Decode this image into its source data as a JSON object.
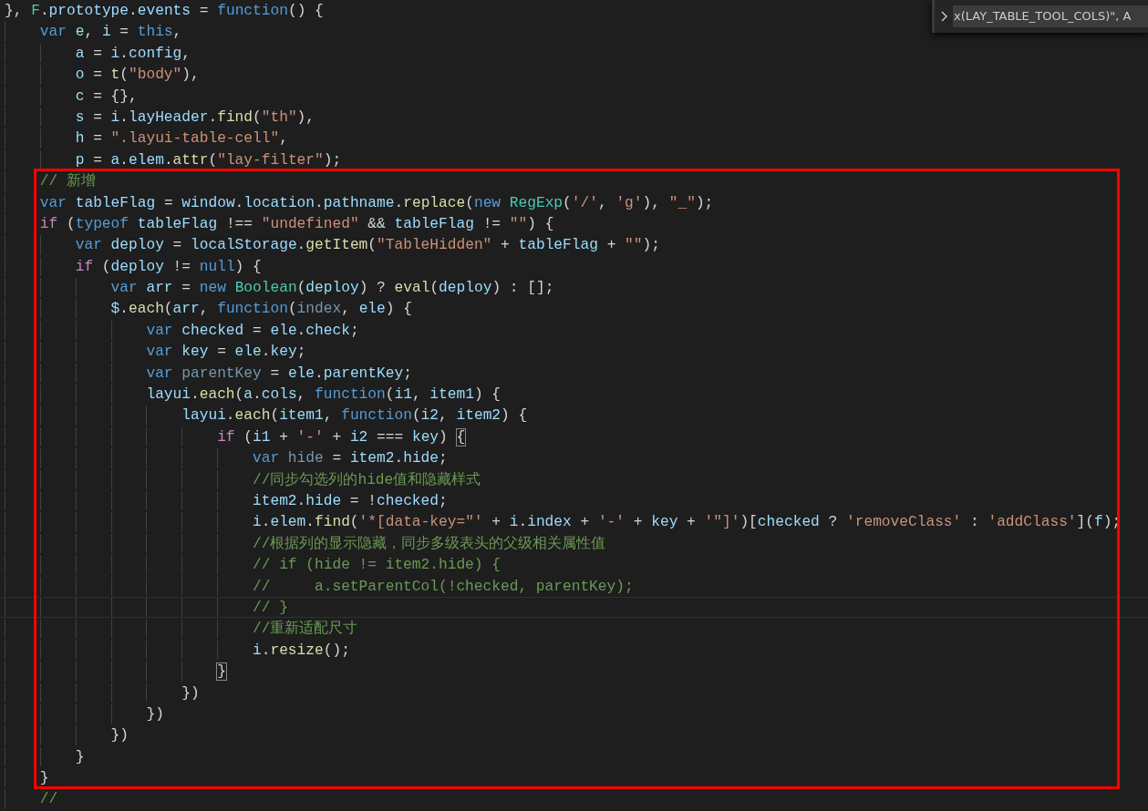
{
  "editor": {
    "lines": [
      {
        "current": false,
        "tokens": [
          {
            "kind": "plain",
            "text": "},"
          },
          {
            "kind": "type",
            "text": "F"
          },
          {
            "kind": "plain",
            "text": "."
          },
          {
            "kind": "variable",
            "text": "prototype"
          },
          {
            "kind": "plain",
            "text": "."
          },
          {
            "kind": "variable",
            "text": "events"
          },
          {
            "kind": "plain",
            "text": "="
          },
          {
            "kind": "keyword",
            "text": "function"
          },
          {
            "kind": "plain",
            "text": "() {"
          }
        ],
        "children": [
          {
            "current": false,
            "tokens": [
              {
                "kind": "keyword",
                "text": "var"
              },
              {
                "kind": "variable",
                "text": "e"
              },
              {
                "kind": "plain",
                "text": ","
              },
              {
                "kind": "variable",
                "text": "i"
              },
              {
                "kind": "plain",
                "text": "="
              },
              {
                "kind": "keyword",
                "text": "this"
              },
              {
                "kind": "plain",
                "text": ","
              }
            ],
            "children": [
              {
                "current": false,
                "tokens": [
                  {
                    "kind": "variable",
                    "text": "a"
                  },
                  {
                    "kind": "plain",
                    "text": "="
                  },
                  {
                    "kind": "variable",
                    "text": "i"
                  },
                  {
                    "kind": "plain",
                    "text": "."
                  },
                  {
                    "kind": "variable",
                    "text": "config"
                  },
                  {
                    "kind": "plain",
                    "text": ","
                  }
                ]
              },
              {
                "current": false,
                "tokens": [
                  {
                    "kind": "variable",
                    "text": "o"
                  },
                  {
                    "kind": "plain",
                    "text": "="
                  },
                  {
                    "kind": "function",
                    "text": "t"
                  },
                  {
                    "kind": "plain",
                    "text": "("
                  },
                  {
                    "kind": "string",
                    "text": "\"body\""
                  },
                  {
                    "kind": "plain",
                    "text": "),"
                  }
                ]
              },
              {
                "current": false,
                "tokens": [
                  {
                    "kind": "variable",
                    "text": "c"
                  },
                  {
                    "kind": "plain",
                    "text": "= {},"
                  }
                ]
              },
              {
                "current": false,
                "tokens": [
                  {
                    "kind": "variable",
                    "text": "s"
                  },
                  {
                    "kind": "plain",
                    "text": "="
                  },
                  {
                    "kind": "variable",
                    "text": "i"
                  },
                  {
                    "kind": "plain",
                    "text": "."
                  },
                  {
                    "kind": "variable",
                    "text": "layHeader"
                  },
                  {
                    "kind": "plain",
                    "text": "."
                  },
                  {
                    "kind": "function",
                    "text": "find"
                  },
                  {
                    "kind": "plain",
                    "text": "("
                  },
                  {
                    "kind": "string",
                    "text": "\"th\""
                  },
                  {
                    "kind": "plain",
                    "text": "),"
                  }
                ]
              },
              {
                "current": false,
                "tokens": [
                  {
                    "kind": "variable",
                    "text": "h"
                  },
                  {
                    "kind": "plain",
                    "text": "="
                  },
                  {
                    "kind": "string",
                    "text": "\".layui-table-cell\""
                  },
                  {
                    "kind": "plain",
                    "text": ","
                  }
                ]
              },
              {
                "current": false,
                "tokens": [
                  {
                    "kind": "variable",
                    "text": "p"
                  },
                  {
                    "kind": "plain",
                    "text": "="
                  },
                  {
                    "kind": "variable",
                    "text": "a"
                  },
                  {
                    "kind": "plain",
                    "text": "."
                  },
                  {
                    "kind": "variable",
                    "text": "elem"
                  },
                  {
                    "kind": "plain",
                    "text": "."
                  },
                  {
                    "kind": "function",
                    "text": "attr"
                  },
                  {
                    "kind": "plain",
                    "text": "("
                  },
                  {
                    "kind": "string",
                    "text": "\"lay-filter\""
                  },
                  {
                    "kind": "plain",
                    "text": ");"
                  }
                ]
              }
            ]
          },
          {
            "current": false,
            "tokens": [
              {
                "kind": "comment",
                "text": "// 新增"
              }
            ]
          },
          {
            "current": false,
            "tokens": [
              {
                "kind": "keyword",
                "text": "var"
              },
              {
                "kind": "variable",
                "text": "tableFlag"
              },
              {
                "kind": "plain",
                "text": "="
              },
              {
                "kind": "variable",
                "text": "window"
              },
              {
                "kind": "plain",
                "text": "."
              },
              {
                "kind": "variable",
                "text": "location"
              },
              {
                "kind": "plain",
                "text": "."
              },
              {
                "kind": "variable",
                "text": "pathname"
              },
              {
                "kind": "plain",
                "text": "."
              },
              {
                "kind": "function",
                "text": "replace"
              },
              {
                "kind": "plain",
                "text": "("
              },
              {
                "kind": "keyword",
                "text": "new"
              },
              {
                "kind": "type",
                "text": "RegExp"
              },
              {
                "kind": "plain",
                "text": "("
              },
              {
                "kind": "string",
                "text": "'/'"
              },
              {
                "kind": "plain",
                "text": ","
              },
              {
                "kind": "string",
                "text": "'g'"
              },
              {
                "kind": "plain",
                "text": "),"
              },
              {
                "kind": "string",
                "text": "\"_\""
              },
              {
                "kind": "plain",
                "text": ");"
              }
            ]
          },
          {
            "current": false,
            "tokens": [
              {
                "kind": "control",
                "text": "if"
              },
              {
                "kind": "plain",
                "text": "("
              },
              {
                "kind": "keyword",
                "text": "typeof"
              },
              {
                "kind": "variable",
                "text": "tableFlag"
              },
              {
                "kind": "plain",
                "text": "!=="
              },
              {
                "kind": "string",
                "text": "\"undefined\""
              },
              {
                "kind": "plain",
                "text": "&&"
              },
              {
                "kind": "variable",
                "text": "tableFlag"
              },
              {
                "kind": "plain",
                "text": "!="
              },
              {
                "kind": "string",
                "text": "\"\""
              },
              {
                "kind": "plain",
                "text": ") {"
              }
            ],
            "children": [
              {
                "current": false,
                "tokens": [
                  {
                    "kind": "keyword",
                    "text": "var"
                  },
                  {
                    "kind": "variable",
                    "text": "deploy"
                  },
                  {
                    "kind": "plain",
                    "text": "="
                  },
                  {
                    "kind": "variable",
                    "text": "localStorage"
                  },
                  {
                    "kind": "plain",
                    "text": "."
                  },
                  {
                    "kind": "function",
                    "text": "getItem"
                  },
                  {
                    "kind": "plain",
                    "text": "("
                  },
                  {
                    "kind": "string",
                    "text": "\"TableHidden\""
                  },
                  {
                    "kind": "plain",
                    "text": "+"
                  },
                  {
                    "kind": "variable",
                    "text": "tableFlag"
                  },
                  {
                    "kind": "plain",
                    "text": "+"
                  },
                  {
                    "kind": "string",
                    "text": "\"\""
                  },
                  {
                    "kind": "plain",
                    "text": ");"
                  }
                ]
              },
              {
                "current": false,
                "tokens": [
                  {
                    "kind": "control",
                    "text": "if"
                  },
                  {
                    "kind": "plain",
                    "text": "("
                  },
                  {
                    "kind": "variable",
                    "text": "deploy"
                  },
                  {
                    "kind": "plain",
                    "text": "!="
                  },
                  {
                    "kind": "keyword",
                    "text": "null"
                  },
                  {
                    "kind": "plain",
                    "text": ") {"
                  }
                ],
                "children": [
                  {
                    "current": false,
                    "tokens": [
                      {
                        "kind": "keyword",
                        "text": "var"
                      },
                      {
                        "kind": "variable",
                        "text": "arr"
                      },
                      {
                        "kind": "plain",
                        "text": "="
                      },
                      {
                        "kind": "keyword",
                        "text": "new"
                      },
                      {
                        "kind": "type",
                        "text": "Boolean"
                      },
                      {
                        "kind": "plain",
                        "text": "("
                      },
                      {
                        "kind": "variable",
                        "text": "deploy"
                      },
                      {
                        "kind": "plain",
                        "text": ") ?"
                      },
                      {
                        "kind": "function",
                        "text": "eval"
                      },
                      {
                        "kind": "plain",
                        "text": "("
                      },
                      {
                        "kind": "variable",
                        "text": "deploy"
                      },
                      {
                        "kind": "plain",
                        "text": ") : [];"
                      }
                    ]
                  },
                  {
                    "current": false,
                    "tokens": [
                      {
                        "kind": "variable",
                        "text": "$"
                      },
                      {
                        "kind": "plain",
                        "text": "."
                      },
                      {
                        "kind": "function",
                        "text": "each"
                      },
                      {
                        "kind": "plain",
                        "text": "("
                      },
                      {
                        "kind": "variable",
                        "text": "arr"
                      },
                      {
                        "kind": "plain",
                        "text": ","
                      },
                      {
                        "kind": "keyword",
                        "text": "function"
                      },
                      {
                        "kind": "plain",
                        "text": "("
                      },
                      {
                        "kind": "unused",
                        "text": "index"
                      },
                      {
                        "kind": "plain",
                        "text": ","
                      },
                      {
                        "kind": "variable",
                        "text": "ele"
                      },
                      {
                        "kind": "plain",
                        "text": ") {"
                      }
                    ],
                    "children": [
                      {
                        "current": false,
                        "tokens": [
                          {
                            "kind": "keyword",
                            "text": "var"
                          },
                          {
                            "kind": "variable",
                            "text": "checked"
                          },
                          {
                            "kind": "plain",
                            "text": "="
                          },
                          {
                            "kind": "variable",
                            "text": "ele"
                          },
                          {
                            "kind": "plain",
                            "text": "."
                          },
                          {
                            "kind": "variable",
                            "text": "check"
                          },
                          {
                            "kind": "plain",
                            "text": ";"
                          }
                        ]
                      },
                      {
                        "current": false,
                        "tokens": [
                          {
                            "kind": "keyword",
                            "text": "var"
                          },
                          {
                            "kind": "variable",
                            "text": "key"
                          },
                          {
                            "kind": "plain",
                            "text": "="
                          },
                          {
                            "kind": "variable",
                            "text": "ele"
                          },
                          {
                            "kind": "plain",
                            "text": "."
                          },
                          {
                            "kind": "variable",
                            "text": "key"
                          },
                          {
                            "kind": "plain",
                            "text": ";"
                          }
                        ]
                      },
                      {
                        "current": false,
                        "tokens": [
                          {
                            "kind": "keyword",
                            "text": "var"
                          },
                          {
                            "kind": "unused",
                            "text": "parentKey"
                          },
                          {
                            "kind": "plain",
                            "text": "="
                          },
                          {
                            "kind": "variable",
                            "text": "ele"
                          },
                          {
                            "kind": "plain",
                            "text": "."
                          },
                          {
                            "kind": "variable",
                            "text": "parentKey"
                          },
                          {
                            "kind": "plain",
                            "text": ";"
                          }
                        ]
                      },
                      {
                        "current": false,
                        "tokens": [
                          {
                            "kind": "variable",
                            "text": "layui"
                          },
                          {
                            "kind": "plain",
                            "text": "."
                          },
                          {
                            "kind": "function",
                            "text": "each"
                          },
                          {
                            "kind": "plain",
                            "text": "("
                          },
                          {
                            "kind": "variable",
                            "text": "a"
                          },
                          {
                            "kind": "plain",
                            "text": "."
                          },
                          {
                            "kind": "variable",
                            "text": "cols"
                          },
                          {
                            "kind": "plain",
                            "text": ","
                          },
                          {
                            "kind": "keyword",
                            "text": "function"
                          },
                          {
                            "kind": "plain",
                            "text": "("
                          },
                          {
                            "kind": "variable",
                            "text": "i1"
                          },
                          {
                            "kind": "plain",
                            "text": ","
                          },
                          {
                            "kind": "variable",
                            "text": "item1"
                          },
                          {
                            "kind": "plain",
                            "text": ") {"
                          }
                        ],
                        "children": [
                          {
                            "current": false,
                            "tokens": [
                              {
                                "kind": "variable",
                                "text": "layui"
                              },
                              {
                                "kind": "plain",
                                "text": "."
                              },
                              {
                                "kind": "function",
                                "text": "each"
                              },
                              {
                                "kind": "plain",
                                "text": "("
                              },
                              {
                                "kind": "variable",
                                "text": "item1"
                              },
                              {
                                "kind": "plain",
                                "text": ","
                              },
                              {
                                "kind": "keyword",
                                "text": "function"
                              },
                              {
                                "kind": "plain",
                                "text": "("
                              },
                              {
                                "kind": "variable",
                                "text": "i2"
                              },
                              {
                                "kind": "plain",
                                "text": ","
                              },
                              {
                                "kind": "variable",
                                "text": "item2"
                              },
                              {
                                "kind": "plain",
                                "text": ") {"
                              }
                            ],
                            "children": [
                              {
                                "current": false,
                                "tokens": [
                                  {
                                    "kind": "control",
                                    "text": "if"
                                  },
                                  {
                                    "kind": "plain",
                                    "text": "("
                                  },
                                  {
                                    "kind": "variable",
                                    "text": "i1"
                                  },
                                  {
                                    "kind": "plain",
                                    "text": "+"
                                  },
                                  {
                                    "kind": "string",
                                    "text": "'-'"
                                  },
                                  {
                                    "kind": "plain",
                                    "text": "+"
                                  },
                                  {
                                    "kind": "variable",
                                    "text": "i2"
                                  },
                                  {
                                    "kind": "plain",
                                    "text": "==="
                                  },
                                  {
                                    "kind": "variable",
                                    "text": "key"
                                  },
                                  {
                                    "kind": "plain",
                                    "text": ")"
                                  },
                                  {
                                    "kind": "bracket",
                                    "text": "{"
                                  }
                                ],
                                "children": [
                                  {
                                    "current": false,
                                    "tokens": [
                                      {
                                        "kind": "keyword",
                                        "text": "var"
                                      },
                                      {
                                        "kind": "unused",
                                        "text": "hide"
                                      },
                                      {
                                        "kind": "plain",
                                        "text": "="
                                      },
                                      {
                                        "kind": "variable",
                                        "text": "item2"
                                      },
                                      {
                                        "kind": "plain",
                                        "text": "."
                                      },
                                      {
                                        "kind": "variable",
                                        "text": "hide"
                                      },
                                      {
                                        "kind": "plain",
                                        "text": ";"
                                      }
                                    ]
                                  },
                                  {
                                    "current": false,
                                    "tokens": [
                                      {
                                        "kind": "comment",
                                        "text": "//同步勾选列的hide值和隐藏样式"
                                      }
                                    ]
                                  },
                                  {
                                    "current": false,
                                    "tokens": [
                                      {
                                        "kind": "variable",
                                        "text": "item2"
                                      },
                                      {
                                        "kind": "plain",
                                        "text": "."
                                      },
                                      {
                                        "kind": "variable",
                                        "text": "hide"
                                      },
                                      {
                                        "kind": "plain",
                                        "text": "= !"
                                      },
                                      {
                                        "kind": "variable",
                                        "text": "checked"
                                      },
                                      {
                                        "kind": "plain",
                                        "text": ";"
                                      }
                                    ]
                                  },
                                  {
                                    "current": false,
                                    "tokens": [
                                      {
                                        "kind": "variable",
                                        "text": "i"
                                      },
                                      {
                                        "kind": "plain",
                                        "text": "."
                                      },
                                      {
                                        "kind": "variable",
                                        "text": "elem"
                                      },
                                      {
                                        "kind": "plain",
                                        "text": "."
                                      },
                                      {
                                        "kind": "function",
                                        "text": "find"
                                      },
                                      {
                                        "kind": "plain",
                                        "text": "("
                                      },
                                      {
                                        "kind": "string",
                                        "text": "'*[data-key=\"'"
                                      },
                                      {
                                        "kind": "plain",
                                        "text": "+"
                                      },
                                      {
                                        "kind": "variable",
                                        "text": "i"
                                      },
                                      {
                                        "kind": "plain",
                                        "text": "."
                                      },
                                      {
                                        "kind": "variable",
                                        "text": "index"
                                      },
                                      {
                                        "kind": "plain",
                                        "text": "+"
                                      },
                                      {
                                        "kind": "string",
                                        "text": "'-'"
                                      },
                                      {
                                        "kind": "plain",
                                        "text": "+"
                                      },
                                      {
                                        "kind": "variable",
                                        "text": "key"
                                      },
                                      {
                                        "kind": "plain",
                                        "text": "+"
                                      },
                                      {
                                        "kind": "string",
                                        "text": "'\"]'"
                                      },
                                      {
                                        "kind": "plain",
                                        "text": ")["
                                      },
                                      {
                                        "kind": "variable",
                                        "text": "checked"
                                      },
                                      {
                                        "kind": "plain",
                                        "text": "?"
                                      },
                                      {
                                        "kind": "string",
                                        "text": "'removeClass'"
                                      },
                                      {
                                        "kind": "plain",
                                        "text": ":"
                                      },
                                      {
                                        "kind": "string",
                                        "text": "'addClass'"
                                      },
                                      {
                                        "kind": "plain",
                                        "text": "]("
                                      },
                                      {
                                        "kind": "variable",
                                        "text": "f"
                                      },
                                      {
                                        "kind": "plain",
                                        "text": ");"
                                      }
                                    ]
                                  },
                                  {
                                    "current": false,
                                    "tokens": [
                                      {
                                        "kind": "comment",
                                        "text": "//根据列的显示隐藏，同步多级表头的父级相关属性值"
                                      }
                                    ]
                                  },
                                  {
                                    "current": false,
                                    "tokens": [
                                      {
                                        "kind": "comment",
                                        "text": "// if (hide != item2.hide) {"
                                      }
                                    ]
                                  },
                                  {
                                    "current": false,
                                    "tokens": [
                                      {
                                        "kind": "comment",
                                        "text": "//     a.setParentCol(!checked, parentKey);"
                                      }
                                    ]
                                  },
                                  {
                                    "current": true,
                                    "tokens": [
                                      {
                                        "kind": "comment",
                                        "text": "// }"
                                      }
                                    ]
                                  },
                                  {
                                    "current": false,
                                    "tokens": [
                                      {
                                        "kind": "comment",
                                        "text": "//重新适配尺寸"
                                      }
                                    ]
                                  },
                                  {
                                    "current": false,
                                    "tokens": [
                                      {
                                        "kind": "variable",
                                        "text": "i"
                                      },
                                      {
                                        "kind": "plain",
                                        "text": "."
                                      },
                                      {
                                        "kind": "function",
                                        "text": "resize"
                                      },
                                      {
                                        "kind": "plain",
                                        "text": "();"
                                      }
                                    ]
                                  }
                                ]
                              },
                              {
                                "current": false,
                                "tokens": [
                                  {
                                    "kind": "bracket",
                                    "text": "}"
                                  }
                                ]
                              }
                            ]
                          },
                          {
                            "current": false,
                            "tokens": [
                              {
                                "kind": "plain",
                                "text": "})"
                              }
                            ]
                          }
                        ]
                      },
                      {
                        "current": false,
                        "tokens": [
                          {
                            "kind": "plain",
                            "text": "})"
                          }
                        ]
                      }
                    ]
                  },
                  {
                    "current": false,
                    "tokens": [
                      {
                        "kind": "plain",
                        "text": "})"
                      }
                    ]
                  }
                ]
              },
              {
                "current": false,
                "tokens": [
                  {
                    "kind": "plain",
                    "text": "}"
                  }
                ]
              }
            ]
          },
          {
            "current": false,
            "tokens": [
              {
                "kind": "plain",
                "text": "}"
              }
            ]
          },
          {
            "current": false,
            "tokens": [
              {
                "kind": "comment",
                "text": "//"
              }
            ]
          }
        ]
      }
    ]
  },
  "find_widget": {
    "query": "x(LAY_TABLE_TOOL_COLS)\", A"
  }
}
